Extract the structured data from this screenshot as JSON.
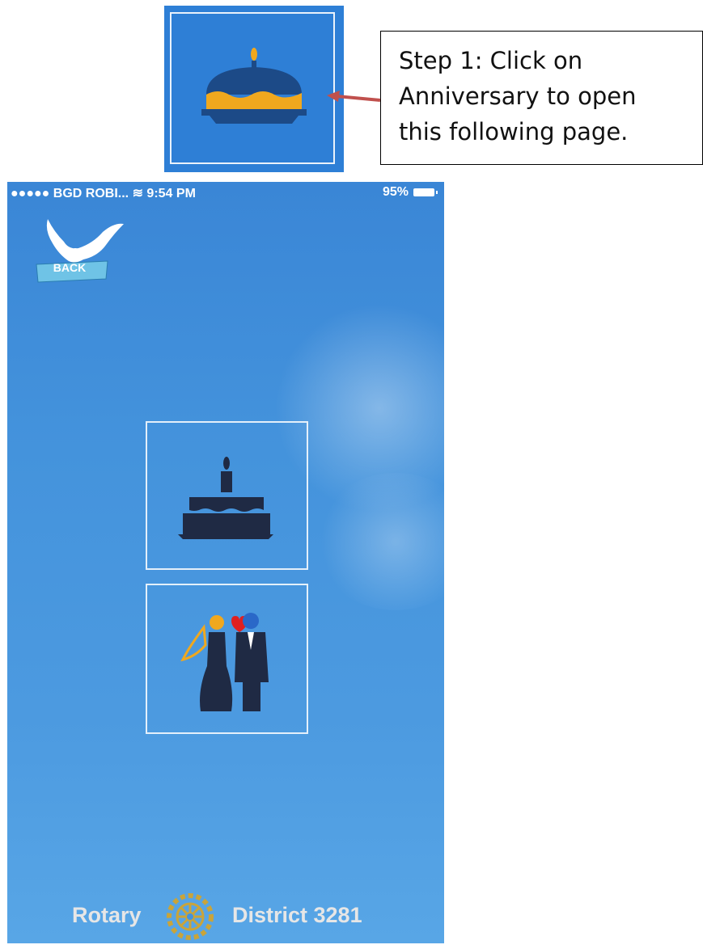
{
  "callout": {
    "lines": [
      "Step 1: Click on",
      "Anniversary to open",
      "this following page."
    ]
  },
  "status_bar": {
    "carrier": "●●●●● BGD ROBI...",
    "time": "9:54 PM",
    "battery": "95%"
  },
  "back_button": {
    "label": "BACK"
  },
  "tiles": [
    {
      "name": "birthday",
      "icon": "cake-icon"
    },
    {
      "name": "anniversary",
      "icon": "couple-icon"
    }
  ],
  "footer": {
    "left": "Rotary",
    "right": "District 3281",
    "logo": "rotary-wheel-icon"
  },
  "colors": {
    "sky": "#4493dc",
    "tile_accent": "#f0a81e",
    "cake_dark": "#1c4a87",
    "arrow": "#c0504d"
  }
}
